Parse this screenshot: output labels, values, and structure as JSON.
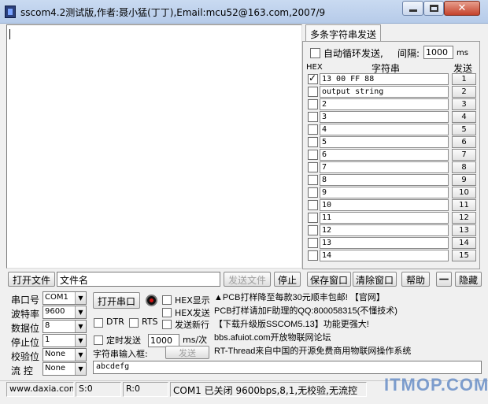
{
  "window": {
    "title": "sscom4.2测试版,作者:聂小猛(丁丁),Email:mcu52@163.com,2007/9"
  },
  "multi_send": {
    "tab_label": "多条字符串发送",
    "auto_loop_label": "自动循环发送,",
    "auto_loop_checked": false,
    "interval_label": "间隔:",
    "interval_value": "1000",
    "interval_unit": "ms",
    "col_hex": "HEX",
    "col_string": "字符串",
    "col_send": "发送",
    "rows": [
      {
        "hex": true,
        "text": "13 00 FF 88",
        "send": "1"
      },
      {
        "hex": false,
        "text": "output string",
        "send": "2"
      },
      {
        "hex": false,
        "text": "2",
        "send": "3"
      },
      {
        "hex": false,
        "text": "3",
        "send": "4"
      },
      {
        "hex": false,
        "text": "4",
        "send": "5"
      },
      {
        "hex": false,
        "text": "5",
        "send": "6"
      },
      {
        "hex": false,
        "text": "6",
        "send": "7"
      },
      {
        "hex": false,
        "text": "7",
        "send": "8"
      },
      {
        "hex": false,
        "text": "8",
        "send": "9"
      },
      {
        "hex": false,
        "text": "9",
        "send": "10"
      },
      {
        "hex": false,
        "text": "10",
        "send": "11"
      },
      {
        "hex": false,
        "text": "11",
        "send": "12"
      },
      {
        "hex": false,
        "text": "12",
        "send": "13"
      },
      {
        "hex": false,
        "text": "13",
        "send": "14"
      },
      {
        "hex": false,
        "text": "14",
        "send": "15"
      }
    ]
  },
  "filebar": {
    "open_file": "打开文件",
    "filename": "文件名",
    "send_file": "发送文件",
    "stop": "停止",
    "save_window": "保存窗口",
    "clear_window": "清除窗口",
    "help": "帮助",
    "dash": "一",
    "hide": "隐藏"
  },
  "settings": {
    "port_label": "串口号",
    "port_value": "COM1",
    "baud_label": "波特率",
    "baud_value": "9600",
    "databits_label": "数据位",
    "databits_value": "8",
    "stopbits_label": "停止位",
    "stopbits_value": "1",
    "parity_label": "校验位",
    "parity_value": "None",
    "flow_label": "流 控",
    "flow_value": "None"
  },
  "controls": {
    "open_port": "打开串口",
    "hex_show": "HEX显示",
    "hex_send": "HEX发送",
    "dtr": "DTR",
    "rts": "RTS",
    "send_newline": "发送新行",
    "timed_send": "定时发送",
    "timer_value": "1000",
    "timer_unit": "ms/次",
    "input_label": "字符串输入框:",
    "send": "发送",
    "send_text": "abcdefg"
  },
  "ads": [
    "▲PCB打样降至每款30元顺丰包邮! 【官网】",
    "PCB打样请加F助理的QQ:800058315(不懂技术)",
    "【下载升级版SSCOM5.13】功能更强大!",
    "bbs.afuiot.com开放物联网论坛",
    "RT-Thread来自中国的开源免费商用物联网操作系统"
  ],
  "status": {
    "url": "www.daxia.com",
    "s": "S:0",
    "r": "R:0",
    "port_status": "COM1 已关闭  9600bps,8,1,无校验,无流控"
  },
  "watermark": "ITMOP.COM"
}
